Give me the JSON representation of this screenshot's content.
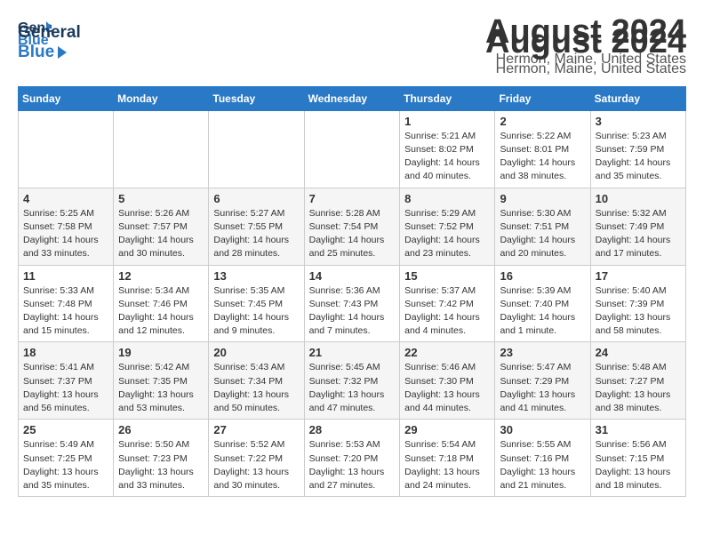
{
  "header": {
    "logo_general": "General",
    "logo_blue": "Blue",
    "title": "August 2024",
    "subtitle": "Hermon, Maine, United States"
  },
  "calendar": {
    "days_of_week": [
      "Sunday",
      "Monday",
      "Tuesday",
      "Wednesday",
      "Thursday",
      "Friday",
      "Saturday"
    ],
    "weeks": [
      [
        {
          "day": "",
          "detail": ""
        },
        {
          "day": "",
          "detail": ""
        },
        {
          "day": "",
          "detail": ""
        },
        {
          "day": "",
          "detail": ""
        },
        {
          "day": "1",
          "detail": "Sunrise: 5:21 AM\nSunset: 8:02 PM\nDaylight: 14 hours\nand 40 minutes."
        },
        {
          "day": "2",
          "detail": "Sunrise: 5:22 AM\nSunset: 8:01 PM\nDaylight: 14 hours\nand 38 minutes."
        },
        {
          "day": "3",
          "detail": "Sunrise: 5:23 AM\nSunset: 7:59 PM\nDaylight: 14 hours\nand 35 minutes."
        }
      ],
      [
        {
          "day": "4",
          "detail": "Sunrise: 5:25 AM\nSunset: 7:58 PM\nDaylight: 14 hours\nand 33 minutes."
        },
        {
          "day": "5",
          "detail": "Sunrise: 5:26 AM\nSunset: 7:57 PM\nDaylight: 14 hours\nand 30 minutes."
        },
        {
          "day": "6",
          "detail": "Sunrise: 5:27 AM\nSunset: 7:55 PM\nDaylight: 14 hours\nand 28 minutes."
        },
        {
          "day": "7",
          "detail": "Sunrise: 5:28 AM\nSunset: 7:54 PM\nDaylight: 14 hours\nand 25 minutes."
        },
        {
          "day": "8",
          "detail": "Sunrise: 5:29 AM\nSunset: 7:52 PM\nDaylight: 14 hours\nand 23 minutes."
        },
        {
          "day": "9",
          "detail": "Sunrise: 5:30 AM\nSunset: 7:51 PM\nDaylight: 14 hours\nand 20 minutes."
        },
        {
          "day": "10",
          "detail": "Sunrise: 5:32 AM\nSunset: 7:49 PM\nDaylight: 14 hours\nand 17 minutes."
        }
      ],
      [
        {
          "day": "11",
          "detail": "Sunrise: 5:33 AM\nSunset: 7:48 PM\nDaylight: 14 hours\nand 15 minutes."
        },
        {
          "day": "12",
          "detail": "Sunrise: 5:34 AM\nSunset: 7:46 PM\nDaylight: 14 hours\nand 12 minutes."
        },
        {
          "day": "13",
          "detail": "Sunrise: 5:35 AM\nSunset: 7:45 PM\nDaylight: 14 hours\nand 9 minutes."
        },
        {
          "day": "14",
          "detail": "Sunrise: 5:36 AM\nSunset: 7:43 PM\nDaylight: 14 hours\nand 7 minutes."
        },
        {
          "day": "15",
          "detail": "Sunrise: 5:37 AM\nSunset: 7:42 PM\nDaylight: 14 hours\nand 4 minutes."
        },
        {
          "day": "16",
          "detail": "Sunrise: 5:39 AM\nSunset: 7:40 PM\nDaylight: 14 hours\nand 1 minute."
        },
        {
          "day": "17",
          "detail": "Sunrise: 5:40 AM\nSunset: 7:39 PM\nDaylight: 13 hours\nand 58 minutes."
        }
      ],
      [
        {
          "day": "18",
          "detail": "Sunrise: 5:41 AM\nSunset: 7:37 PM\nDaylight: 13 hours\nand 56 minutes."
        },
        {
          "day": "19",
          "detail": "Sunrise: 5:42 AM\nSunset: 7:35 PM\nDaylight: 13 hours\nand 53 minutes."
        },
        {
          "day": "20",
          "detail": "Sunrise: 5:43 AM\nSunset: 7:34 PM\nDaylight: 13 hours\nand 50 minutes."
        },
        {
          "day": "21",
          "detail": "Sunrise: 5:45 AM\nSunset: 7:32 PM\nDaylight: 13 hours\nand 47 minutes."
        },
        {
          "day": "22",
          "detail": "Sunrise: 5:46 AM\nSunset: 7:30 PM\nDaylight: 13 hours\nand 44 minutes."
        },
        {
          "day": "23",
          "detail": "Sunrise: 5:47 AM\nSunset: 7:29 PM\nDaylight: 13 hours\nand 41 minutes."
        },
        {
          "day": "24",
          "detail": "Sunrise: 5:48 AM\nSunset: 7:27 PM\nDaylight: 13 hours\nand 38 minutes."
        }
      ],
      [
        {
          "day": "25",
          "detail": "Sunrise: 5:49 AM\nSunset: 7:25 PM\nDaylight: 13 hours\nand 35 minutes."
        },
        {
          "day": "26",
          "detail": "Sunrise: 5:50 AM\nSunset: 7:23 PM\nDaylight: 13 hours\nand 33 minutes."
        },
        {
          "day": "27",
          "detail": "Sunrise: 5:52 AM\nSunset: 7:22 PM\nDaylight: 13 hours\nand 30 minutes."
        },
        {
          "day": "28",
          "detail": "Sunrise: 5:53 AM\nSunset: 7:20 PM\nDaylight: 13 hours\nand 27 minutes."
        },
        {
          "day": "29",
          "detail": "Sunrise: 5:54 AM\nSunset: 7:18 PM\nDaylight: 13 hours\nand 24 minutes."
        },
        {
          "day": "30",
          "detail": "Sunrise: 5:55 AM\nSunset: 7:16 PM\nDaylight: 13 hours\nand 21 minutes."
        },
        {
          "day": "31",
          "detail": "Sunrise: 5:56 AM\nSunset: 7:15 PM\nDaylight: 13 hours\nand 18 minutes."
        }
      ]
    ]
  }
}
